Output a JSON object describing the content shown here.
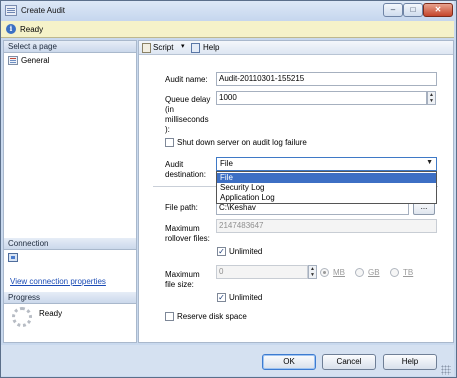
{
  "window": {
    "title": "Create Audit",
    "minimize_glyph": "–",
    "maximize_glyph": "□",
    "close_glyph": "✕"
  },
  "status": {
    "icon": "info-icon",
    "icon_glyph": "i",
    "text": "Ready"
  },
  "left_pane": {
    "select_page_header": "Select a page",
    "pages": [
      {
        "label": "General",
        "icon": "page-icon"
      }
    ],
    "connection_header": "Connection",
    "view_connection_link": "View connection properties",
    "progress_header": "Progress",
    "progress_status": "Ready"
  },
  "toolbar": {
    "script_label": "Script",
    "script_arrow": "▾",
    "help_label": "Help"
  },
  "form": {
    "audit_name_label": "Audit name:",
    "audit_name_value": "Audit-20110301-155215",
    "queue_delay_label_lines": [
      "Queue delay",
      "(in",
      "milliseconds",
      "):"
    ],
    "queue_delay_value": "1000",
    "shutdown_label": "Shut down server on audit log failure",
    "shutdown_checked": false,
    "audit_destination_label_lines": [
      "Audit",
      "destination:"
    ],
    "audit_destination_selected": "File",
    "audit_destination_options": [
      "File",
      "Security Log",
      "Application Log"
    ],
    "file_path_label": "File path:",
    "file_path_value": "C:\\Keshav",
    "browse_label": "...",
    "max_rollover_label_lines": [
      "Maximum",
      "rollover files:"
    ],
    "max_rollover_value": "2147483647",
    "rollover_unlimited_label": "Unlimited",
    "rollover_unlimited_checked": true,
    "max_file_size_label_lines": [
      "Maximum",
      "file size:"
    ],
    "max_file_size_value": "0",
    "size_units": [
      "MB",
      "GB",
      "TB"
    ],
    "size_unit_selected": "MB",
    "file_size_unlimited_label": "Unlimited",
    "file_size_unlimited_checked": true,
    "reserve_disk_label": "Reserve disk space",
    "reserve_disk_checked": false,
    "check_glyph": "✓"
  },
  "buttons": {
    "ok": "OK",
    "cancel": "Cancel",
    "help": "Help"
  }
}
